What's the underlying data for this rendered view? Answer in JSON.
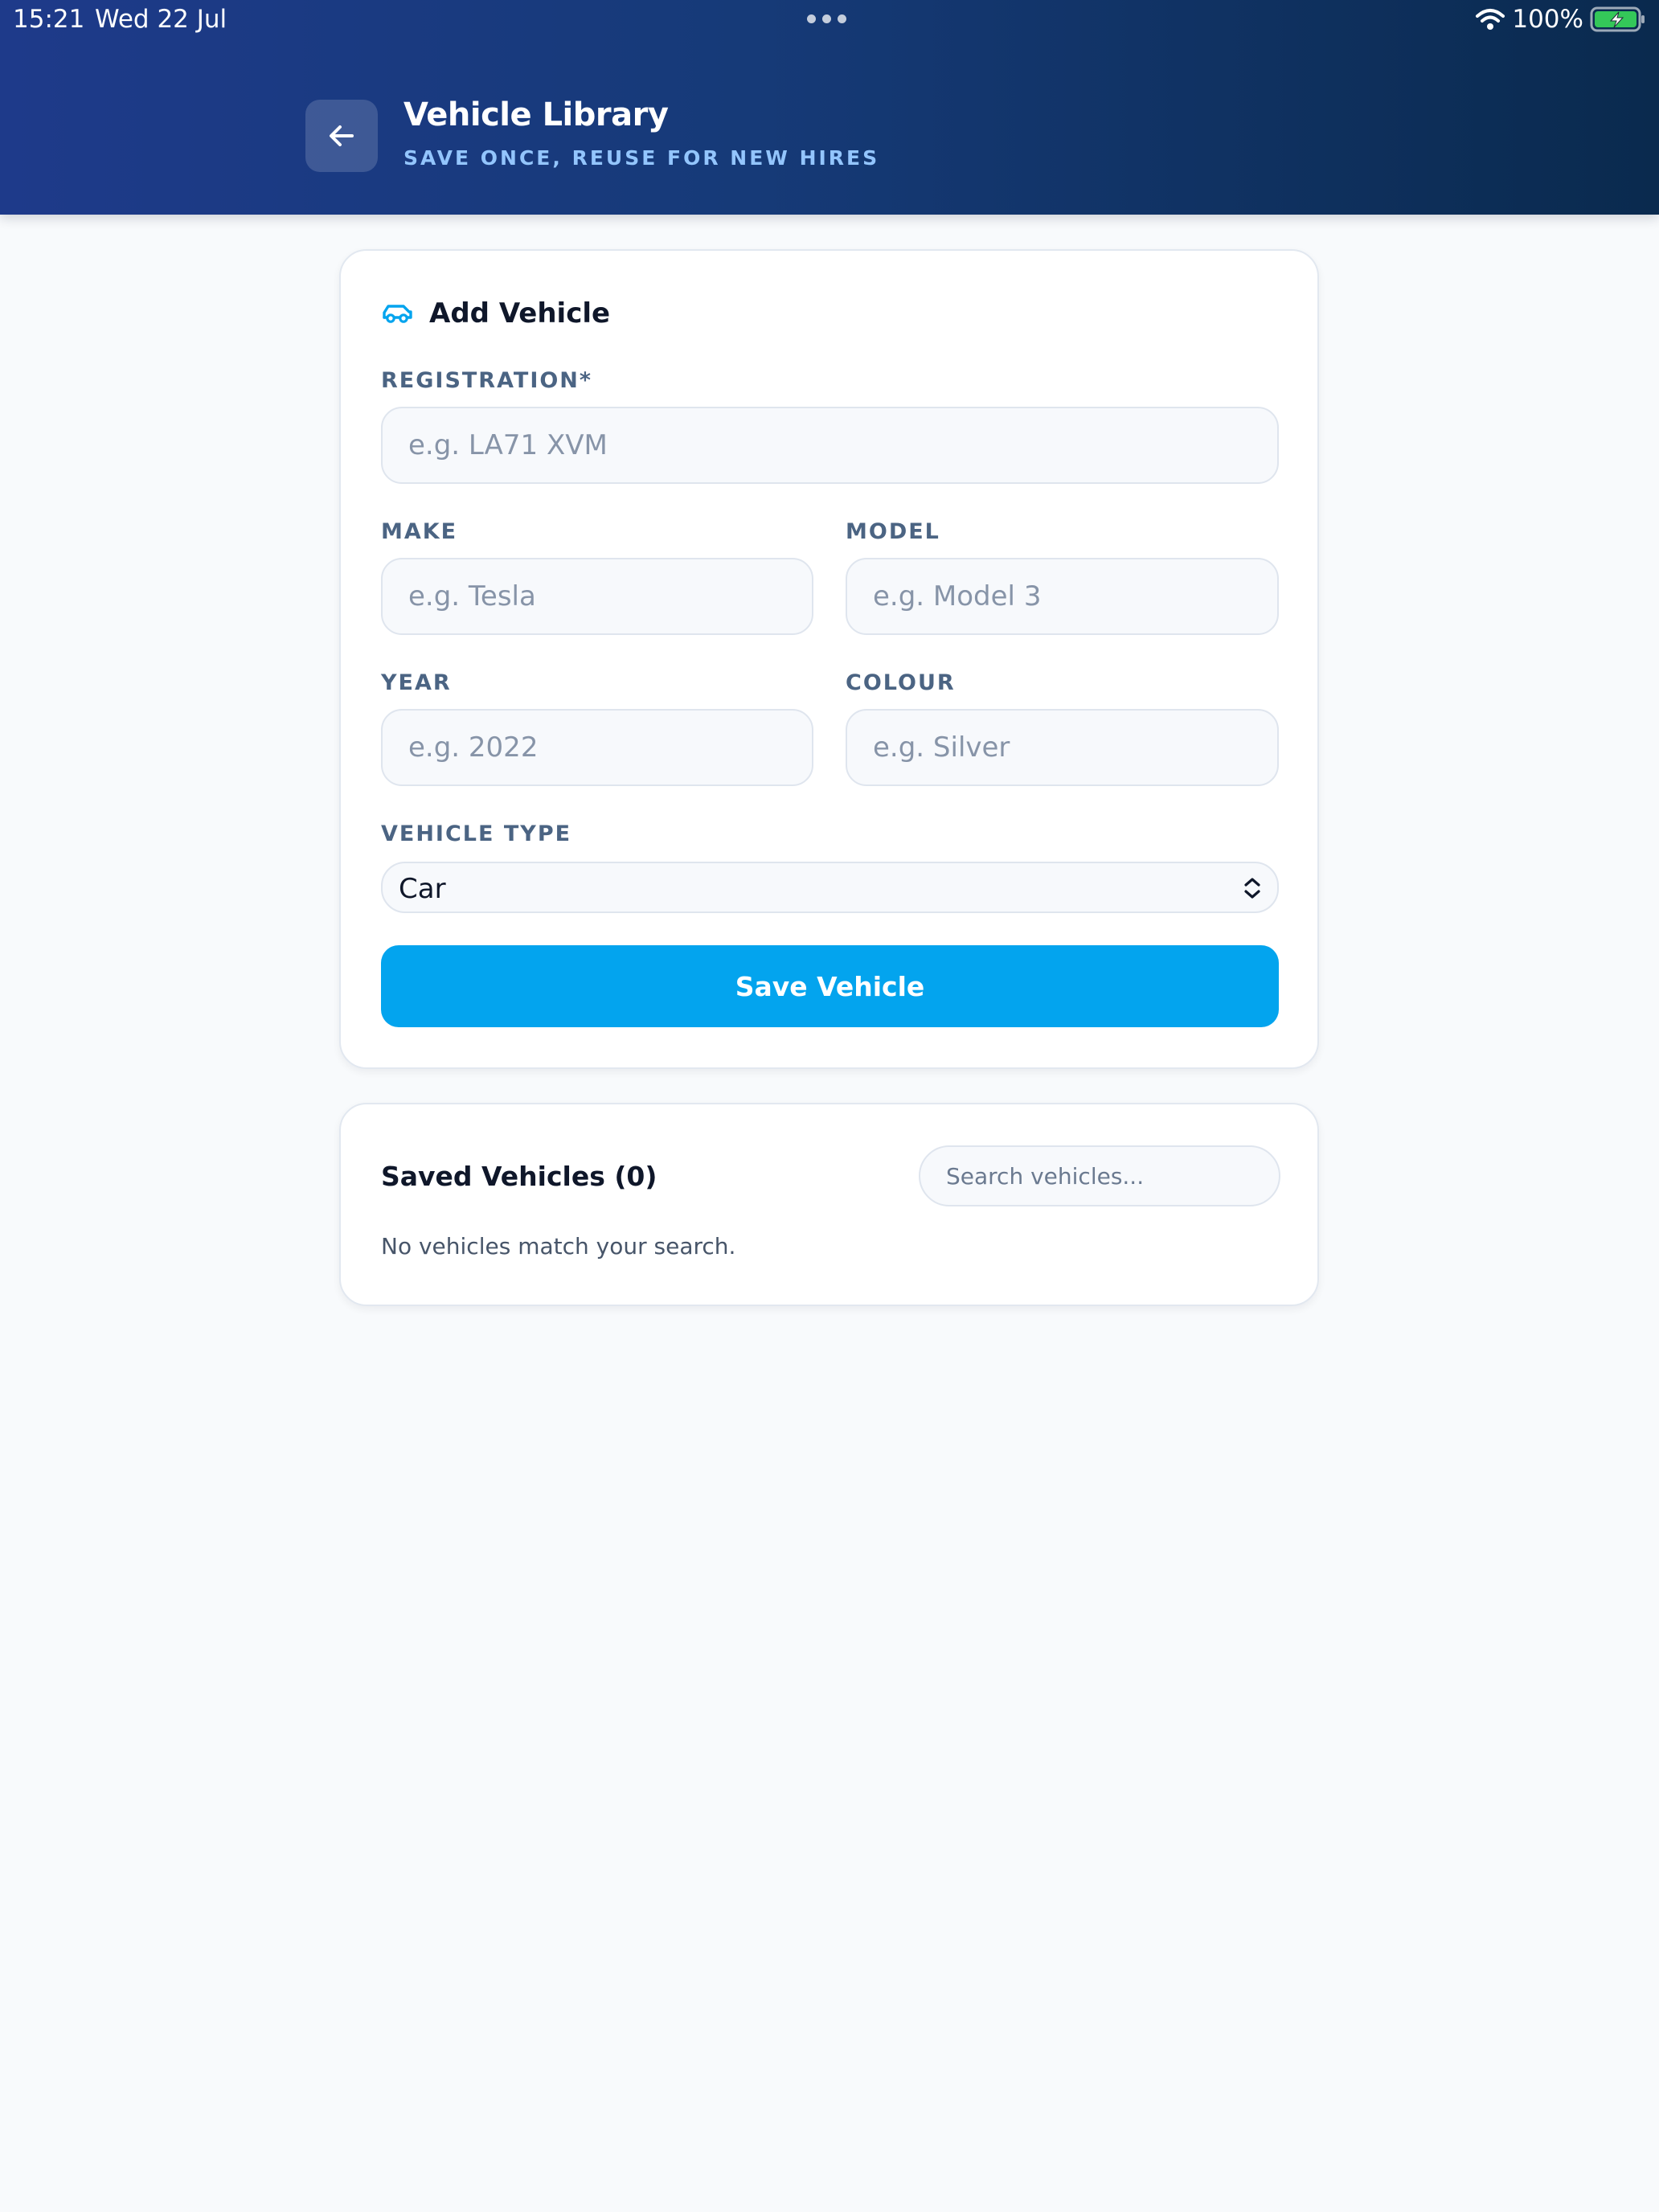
{
  "status_bar": {
    "time": "15:21",
    "date": "Wed 22 Jul",
    "battery": "100%"
  },
  "header": {
    "title": "Vehicle Library",
    "subtitle": "SAVE ONCE, REUSE FOR NEW HIRES"
  },
  "add_vehicle": {
    "title": "Add Vehicle",
    "registration": {
      "label": "REGISTRATION*",
      "placeholder": "e.g. LA71 XVM",
      "value": ""
    },
    "make": {
      "label": "MAKE",
      "placeholder": "e.g. Tesla",
      "value": ""
    },
    "model": {
      "label": "MODEL",
      "placeholder": "e.g. Model 3",
      "value": ""
    },
    "year": {
      "label": "YEAR",
      "placeholder": "e.g. 2022",
      "value": ""
    },
    "colour": {
      "label": "COLOUR",
      "placeholder": "e.g. Silver",
      "value": ""
    },
    "vehicle_type": {
      "label": "VEHICLE TYPE",
      "value": "Car"
    },
    "save_label": "Save Vehicle"
  },
  "saved_vehicles": {
    "title": "Saved Vehicles (0)",
    "search_placeholder": "Search vehicles...",
    "empty_message": "No vehicles match your search."
  },
  "colors": {
    "header_start": "#1e3a8a",
    "header_end": "#0a2a4e",
    "accent": "#03a4ee",
    "label": "#4b6483",
    "background": "#f8fafc"
  },
  "icons": {
    "back": "arrow-left-icon",
    "car": "car-icon",
    "select": "chevron-up-down-icon",
    "wifi": "wifi-icon",
    "battery": "battery-charging-icon"
  }
}
